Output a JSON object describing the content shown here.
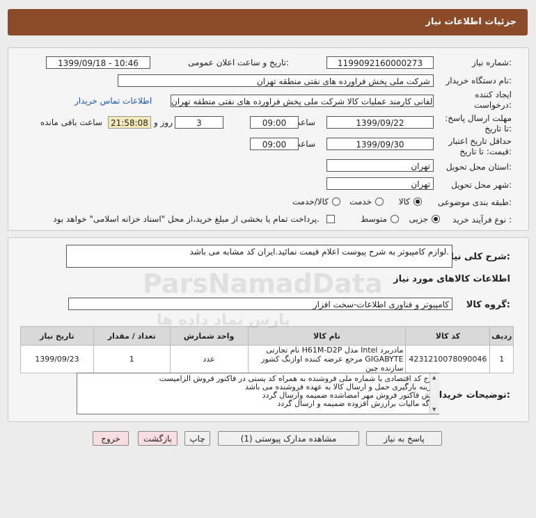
{
  "header": {
    "title": "جزئیات اطلاعات نیاز"
  },
  "form": {
    "need_number_label": "شماره نیاز:",
    "need_number": "1199092160000273",
    "announce_label": "تاریخ و ساعت اعلان عمومی:",
    "announce_value": "1399/09/18 - 10:46",
    "buyer_org_label": "نام دستگاه خریدار:",
    "buyer_org": "شرکت ملی پخش فراورده های نفتی منطقه تهران",
    "creator_label": "ایجاد کننده درخواست:",
    "creator": "مهدی دلفانی کارمند عملیات کالا شرکت ملی پخش فراورده های نفتی منطقه تهران",
    "contact_link": "اطلاعات تماس خریدار",
    "deadline_label": "مهلت ارسال پاسخ: تا تاریخ:",
    "deadline_date": "1399/09/22",
    "time_label": "ساعت",
    "deadline_time": "09:00",
    "day_label": "روز و",
    "days": "3",
    "remaining_timer": "21:58:08",
    "remaining_label": "ساعت باقی مانده",
    "validity_label": "حداقل تاریخ اعتبار قیمت: تا تاریخ:",
    "validity_date": "1399/09/30",
    "validity_time": "09:00",
    "province_label": "استان محل تحویل:",
    "province": "تهران",
    "city_label": "شهر محل تحویل:",
    "city": "تهران",
    "category_label": "طبقه بندی موضوعی:",
    "category_options": [
      "کالا",
      "خدمت",
      "کالا/خدمت"
    ],
    "process_label": "نوع فرآیند خرید :",
    "process_options": [
      "جزیی",
      "متوسط"
    ],
    "payment_note": "پرداخت تمام یا بخشی از مبلغ خرید،از محل \"اسناد خزانه اسلامی\" خواهد بود."
  },
  "summary": {
    "label": "شرح کلی نیاز:",
    "text": "لوازم کامپیوتر به شرح پیوست اعلام قیمت نمائید.ایران کد مشابه می باشد.",
    "goods_info_title": "اطلاعات کالاهای مورد نیاز",
    "group_label": "گروه کالا:",
    "group_value": "کامپیوتر و فناوری اطلاعات-سخت افزار"
  },
  "table": {
    "headers": [
      "ردیف",
      "کد کالا",
      "نام کالا",
      "واحد شمارش",
      "تعداد / مقدار",
      "تاریخ نیاز"
    ],
    "rows": [
      [
        "1",
        "4231210078090046",
        "مادربرد Intel مدل H61M-D2P نام تجارتی GIGABYTE مرجع عرضه کننده اوازنگ کشور سازنده چین",
        "عدد",
        "1",
        "1399/09/23"
      ]
    ]
  },
  "notes": {
    "label": "توضیحات خریدار:",
    "lines": [
      "درج کد اقتصادی یا شماره ملی فروشنده به همراه کد پستی در فاکتور فروش الزامیست",
      "هزینه بارگیری حمل و ارسال کالا به عهده فروشنده می باشد",
      "پیش فاکتور فروش مهر امضاشده ضمیمه وارسال گردد",
      "برگه مالیات برارزش افزوده ضمیمه و ارسال گردد"
    ]
  },
  "buttons": {
    "reply": "پاسخ به نیاز",
    "attachments": "مشاهده مدارک پیوستی (1)",
    "print": "چاپ",
    "back": "بازگشت",
    "exit": "خروج"
  },
  "watermark": {
    "brand": "ParsNamadData",
    "fa": "پارس نماد داده ها"
  }
}
